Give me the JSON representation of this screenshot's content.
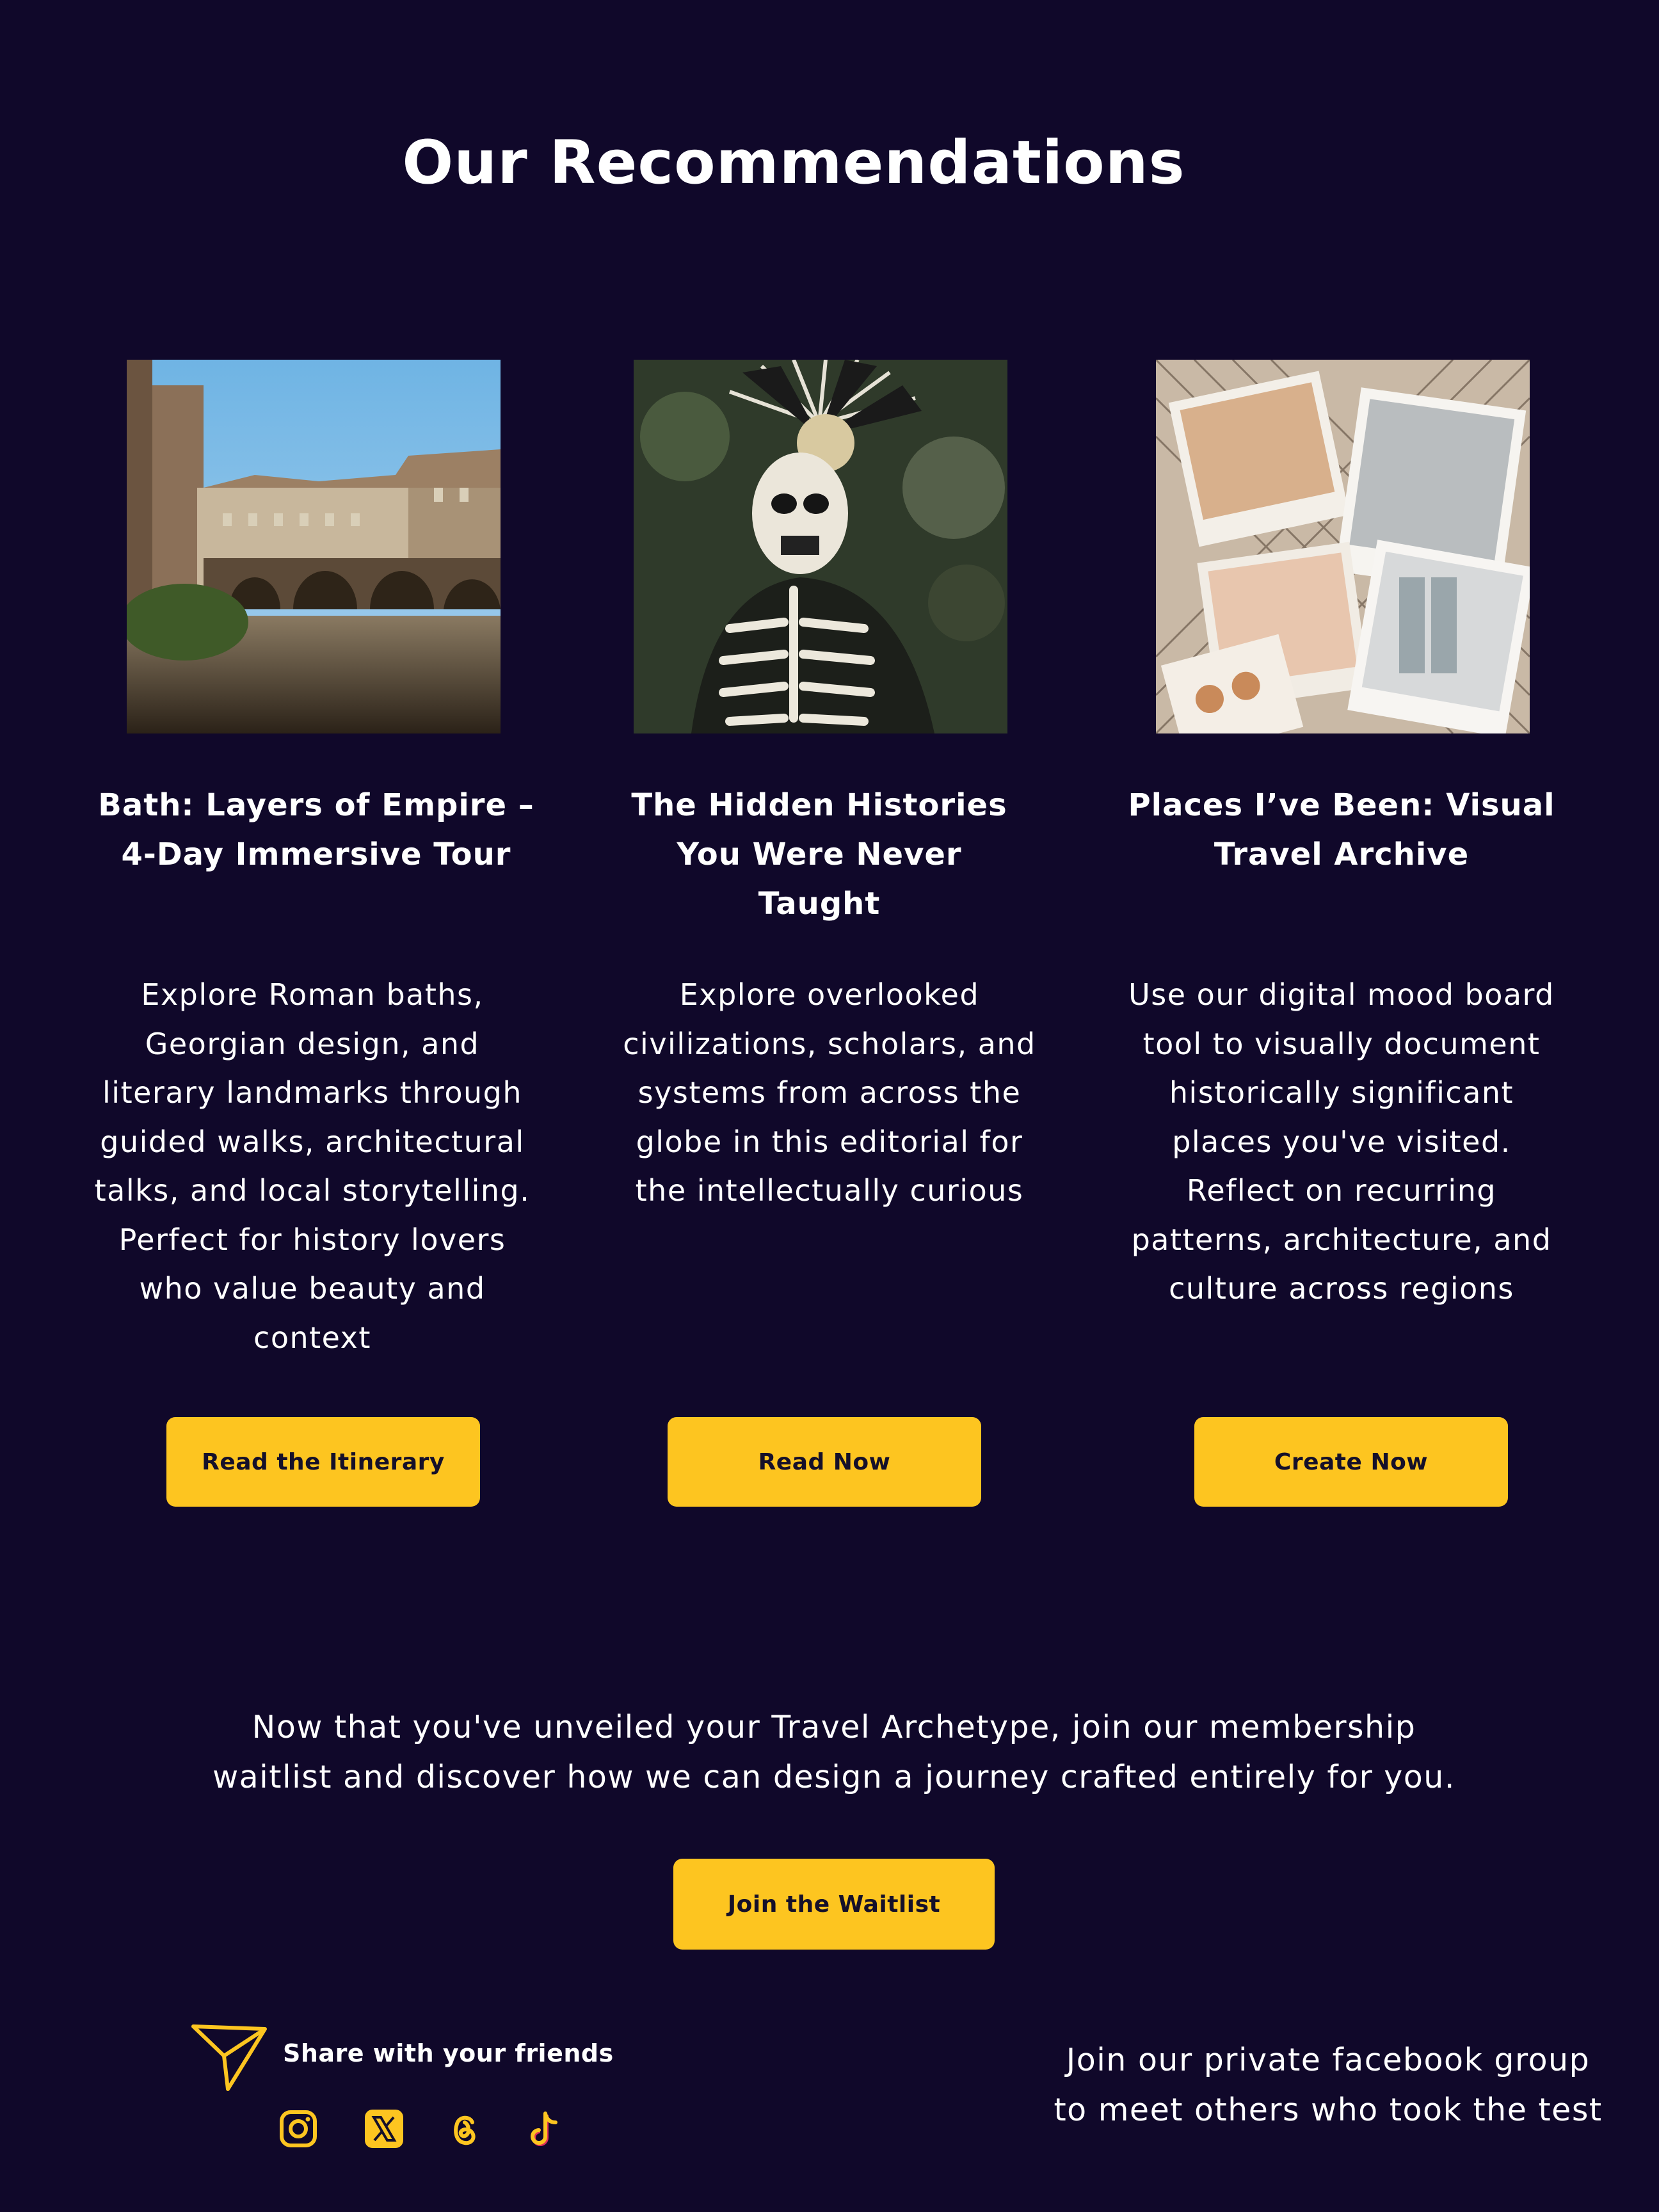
{
  "header": {
    "title": "Our Recommendations"
  },
  "cards": [
    {
      "title_lines": [
        "Bath: Layers of Empire –",
        "4-Day Immersive Tour"
      ],
      "description_lines": [
        "Explore Roman baths,",
        "Georgian design, and",
        "literary landmarks through",
        "guided walks, architectural",
        "talks, and local storytelling.",
        "Perfect for history lovers",
        "who value beauty and",
        "context"
      ],
      "button_label": "Read the Itinerary"
    },
    {
      "title_lines": [
        "The Hidden Histories",
        "You Were Never",
        "Taught"
      ],
      "description_lines": [
        "Explore overlooked",
        "civilizations, scholars, and",
        "systems from across the",
        "globe in this editorial for",
        "the intellectually curious"
      ],
      "button_label": "Read Now"
    },
    {
      "title_lines": [
        "Places I’ve Been: Visual",
        "Travel Archive"
      ],
      "description_lines": [
        "Use our digital mood board",
        "tool to visually document",
        "historically significant",
        "places you've visited.",
        "Reflect on recurring",
        "patterns, architecture, and",
        "culture across regions"
      ],
      "button_label": "Create Now"
    }
  ],
  "cta": {
    "lines": [
      "Now that you've unveiled your Travel Archetype, join our membership",
      "waitlist and discover how we can design a journey crafted entirely for you."
    ],
    "button_label": "Join the Waitlist"
  },
  "share": {
    "label": "Share with your friends",
    "icons": [
      "instagram-icon",
      "x-icon",
      "threads-icon",
      "tiktok-icon"
    ]
  },
  "facebook": {
    "lines": [
      "Join our private facebook group",
      "to meet others who took the test"
    ]
  },
  "colors": {
    "background": "#10082a",
    "accent": "#fdc520",
    "text": "#ffffff"
  }
}
